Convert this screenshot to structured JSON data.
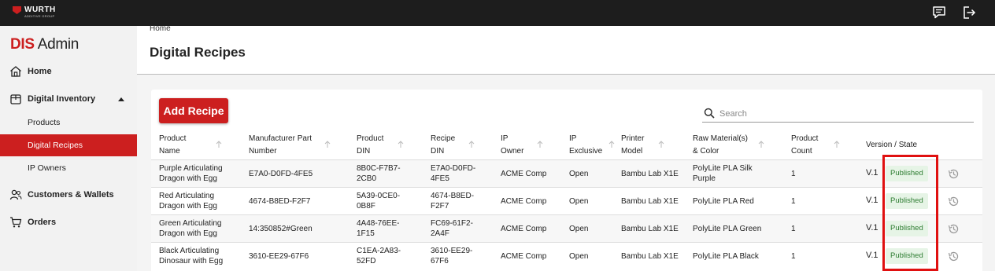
{
  "topbar": {
    "logo_text": "WURTH",
    "logo_sub": "ADDITIVE GROUP",
    "icons": [
      "chat-icon",
      "logout-icon"
    ]
  },
  "sidebar": {
    "brand_primary": "DIS",
    "brand_secondary": "Admin",
    "items": [
      {
        "label": "Home",
        "icon": "home-icon"
      },
      {
        "label": "Digital Inventory",
        "icon": "box-icon"
      },
      {
        "label": "Products"
      },
      {
        "label": "Digital Recipes"
      },
      {
        "label": "IP Owners"
      },
      {
        "label": "Customers & Wallets",
        "icon": "users-icon"
      },
      {
        "label": "Orders",
        "icon": "cart-icon"
      }
    ]
  },
  "page": {
    "breadcrumb": "Home",
    "title": "Digital Recipes"
  },
  "toolbar": {
    "add_label": "Add Recipe",
    "search_placeholder": "Search"
  },
  "table": {
    "columns": [
      {
        "line1": "Product",
        "line2": "Name"
      },
      {
        "line1": "Manufacturer Part",
        "line2": "Number"
      },
      {
        "line1": "Product",
        "line2": "DIN"
      },
      {
        "line1": "Recipe",
        "line2": "DIN"
      },
      {
        "line1": "IP",
        "line2": "Owner"
      },
      {
        "line1": "IP",
        "line2": "Exclusive"
      },
      {
        "line1": "Printer",
        "line2": "Model"
      },
      {
        "line1": "Raw Material(s)",
        "line2": "& Color"
      },
      {
        "line1": "Product",
        "line2": "Count"
      },
      {
        "line1": "Version / State",
        "line2": ""
      }
    ],
    "rows": [
      {
        "name": [
          "Purple Articulating",
          "Dragon with Egg"
        ],
        "mpn": "E7A0-D0FD-4FE5",
        "product_din": [
          "8B0C-F7B7-",
          "2CB0"
        ],
        "recipe_din": [
          "E7A0-D0FD-",
          "4FE5"
        ],
        "ip_owner": "ACME Comp",
        "ip_exclusive": "Open",
        "printer": "Bambu Lab X1E",
        "material": [
          "PolyLite PLA Silk",
          "Purple"
        ],
        "count": "1",
        "version": "V.1",
        "state": "Published"
      },
      {
        "name": [
          "Red Articulating",
          "Dragon with Egg"
        ],
        "mpn": "4674-B8ED-F2F7",
        "product_din": [
          "5A39-0CE0-",
          "0B8F"
        ],
        "recipe_din": [
          "4674-B8ED-",
          "F2F7"
        ],
        "ip_owner": "ACME Comp",
        "ip_exclusive": "Open",
        "printer": "Bambu Lab X1E",
        "material": [
          "PolyLite PLA Red",
          ""
        ],
        "count": "1",
        "version": "V.1",
        "state": "Published"
      },
      {
        "name": [
          "Green Articulating",
          "Dragon with Egg"
        ],
        "mpn": "14:350852#Green",
        "product_din": [
          "4A48-76EE-",
          "1F15"
        ],
        "recipe_din": [
          "FC69-61F2-",
          "2A4F"
        ],
        "ip_owner": "ACME Comp",
        "ip_exclusive": "Open",
        "printer": "Bambu Lab X1E",
        "material": [
          "PolyLite PLA Green",
          ""
        ],
        "count": "1",
        "version": "V.1",
        "state": "Published"
      },
      {
        "name": [
          "Black Articulating",
          "Dinosaur with Egg"
        ],
        "mpn": "3610-EE29-67F6",
        "product_din": [
          "C1EA-2A83-",
          "52FD"
        ],
        "recipe_din": [
          "3610-EE29-",
          "67F6"
        ],
        "ip_owner": "ACME Comp",
        "ip_exclusive": "Open",
        "printer": "Bambu Lab X1E",
        "material": [
          "PolyLite PLA Black",
          ""
        ],
        "count": "1",
        "version": "V.1",
        "state": "Published"
      }
    ]
  },
  "colors": {
    "brand_red": "#cc1f1f",
    "topbar": "#1d1d1d",
    "published_text": "#2e7d32",
    "published_bg": "#e6f4e6",
    "highlight": "#e01010"
  }
}
